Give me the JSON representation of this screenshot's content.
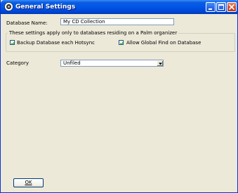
{
  "window": {
    "title": "General Settings"
  },
  "form": {
    "database_name_label": "Database Name:",
    "database_name_value": "My CD Collection",
    "group_legend": "These settings apply only to databases residing on a Palm organizer",
    "backup_label": "Backup Database each Hotsync",
    "backup_checked": true,
    "global_find_label": "Allow Global Find on Database",
    "global_find_checked": true,
    "category_label": "Category",
    "category_value": "Unfiled"
  },
  "buttons": {
    "ok_label": "OK"
  },
  "colors": {
    "titlebar": "#0055e5",
    "window_bg": "#ece9d8",
    "close_button": "#d2502d"
  },
  "icons": {
    "app": "palm-app-icon",
    "minimize": "minimize-icon",
    "maximize": "maximize-icon",
    "close": "close-icon",
    "check": "checkmark-icon",
    "dropdown": "chevron-down-icon"
  }
}
